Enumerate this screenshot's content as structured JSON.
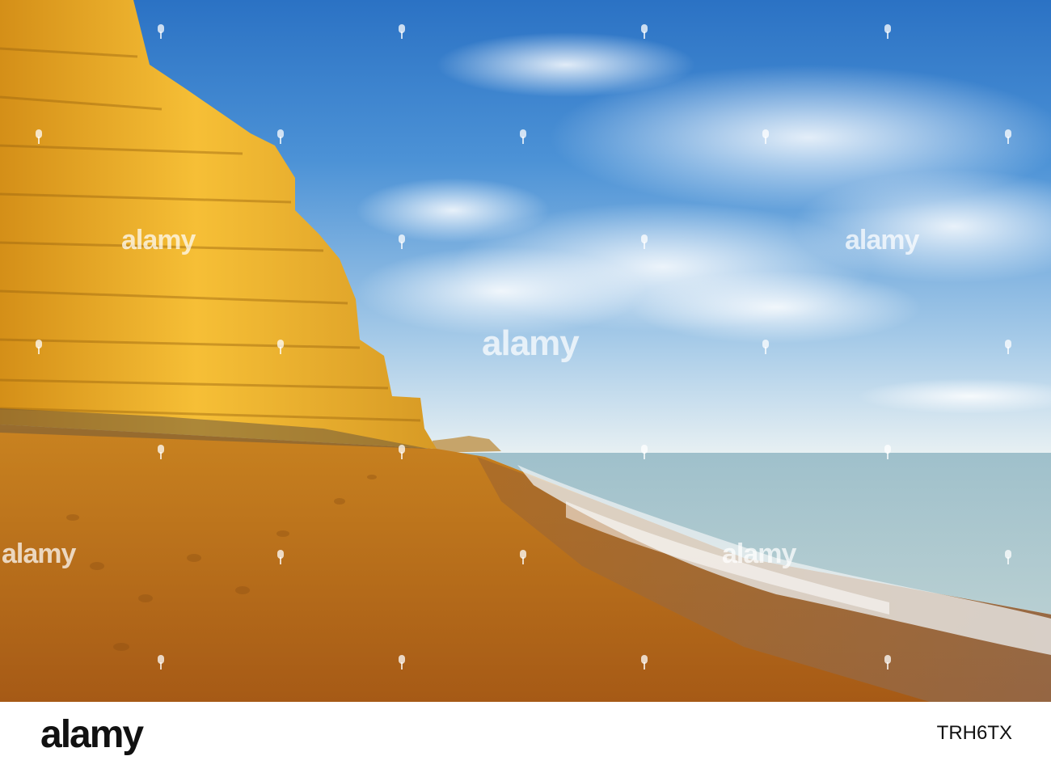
{
  "watermark": {
    "text": "alamy"
  },
  "footer": {
    "brand": "alamy",
    "image_id": "TRH6TX"
  },
  "colors": {
    "sky_top": "#2f79c9",
    "sky_light": "#d8e9f6",
    "cliff": "#f2b230",
    "sand": "#c97b1d",
    "sea": "#aac6cb"
  }
}
